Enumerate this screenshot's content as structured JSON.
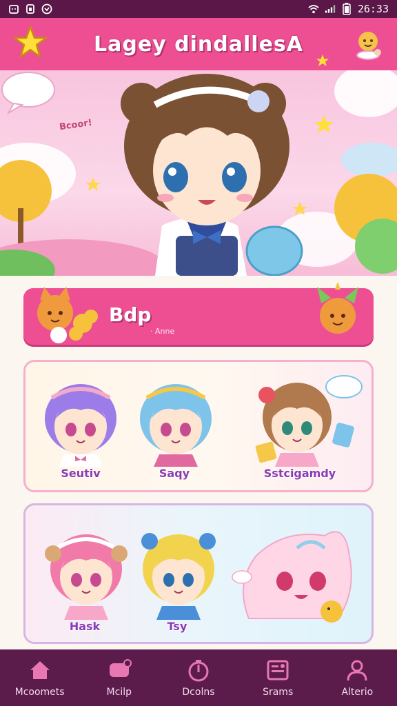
{
  "status_bar": {
    "time": "26:33",
    "icons": [
      "android-icon",
      "sim-icon",
      "message-icon",
      "wifi-icon",
      "signal-icon",
      "battery-icon"
    ]
  },
  "header": {
    "title": "Lagey dindallesA",
    "left_icon": "star-icon",
    "right_icon": "avatar-icon"
  },
  "hero": {
    "bubble_text": "Bcoor!"
  },
  "banner": {
    "title": "Bdp",
    "subtitle": "· Anne"
  },
  "cards": [
    {
      "characters": [
        {
          "name": "Seutiv",
          "hair": "#9b7ce8"
        },
        {
          "name": "Saqy",
          "hair": "#7ec3ea"
        },
        {
          "name": "Sstcigamdy",
          "hair": "#b07a4e"
        }
      ]
    },
    {
      "characters": [
        {
          "name": "Hask",
          "hair": "#f27aa8"
        },
        {
          "name": "Tsy",
          "hair": "#f2d34d"
        },
        {
          "name": "",
          "hair": "#ffd6e6"
        }
      ]
    }
  ],
  "bottom_nav": [
    {
      "label": "Mcoomets",
      "icon": "home-icon"
    },
    {
      "label": "Mcilp",
      "icon": "chat-icon"
    },
    {
      "label": "Dcolns",
      "icon": "timer-icon"
    },
    {
      "label": "Srams",
      "icon": "gallery-icon"
    },
    {
      "label": "Alterio",
      "icon": "profile-icon"
    }
  ],
  "colors": {
    "brand_pink": "#ee4f93",
    "dark_plum": "#5b1c4b",
    "label_purple": "#8a3bb5"
  }
}
